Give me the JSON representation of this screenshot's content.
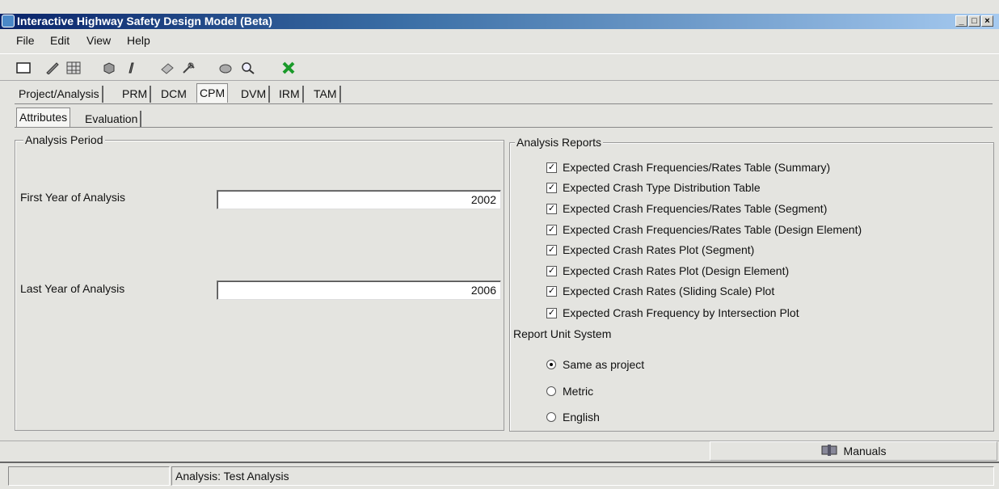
{
  "window": {
    "title": "Interactive Highway Safety Design Model (Beta)",
    "controls": [
      "_",
      "□",
      "×"
    ]
  },
  "menu": [
    "File",
    "Edit",
    "View",
    "Help"
  ],
  "toolbar": {
    "icons": [
      "new-icon",
      "edit-icon",
      "grid-icon",
      "box-icon",
      "pen-icon",
      "erase-icon",
      "tools-icon",
      "print-icon",
      "find-icon",
      "exit-icon"
    ]
  },
  "main_tabs": [
    "Project/Analysis",
    "PRM",
    "DCM",
    "CPM",
    "DVM",
    "IRM",
    "TAM"
  ],
  "active_main_tab": "CPM",
  "sub_tabs": [
    "Attributes",
    "Evaluation"
  ],
  "active_sub_tab": "Attributes",
  "analysis_period": {
    "legend": "Analysis Period",
    "first_year_label": "First Year of Analysis",
    "first_year_value": "2002",
    "last_year_label": "Last Year of Analysis",
    "last_year_value": "2006"
  },
  "analysis_reports": {
    "legend": "Analysis Reports",
    "items": [
      {
        "label": "Expected Crash Frequencies/Rates Table (Summary)",
        "checked": true
      },
      {
        "label": "Expected Crash Type Distribution Table",
        "checked": true
      },
      {
        "label": "Expected Crash Frequencies/Rates Table (Segment)",
        "checked": true
      },
      {
        "label": "Expected Crash Frequencies/Rates Table (Design Element)",
        "checked": true
      },
      {
        "label": "Expected Crash Rates Plot (Segment)",
        "checked": true
      },
      {
        "label": "Expected Crash Rates Plot (Design Element)",
        "checked": true
      },
      {
        "label": "Expected Crash Rates (Sliding Scale) Plot",
        "checked": true
      },
      {
        "label": "Expected Crash Frequency by Intersection Plot",
        "checked": true
      }
    ],
    "unit_system_label": "Report Unit System",
    "unit_options": [
      {
        "label": "Same as project",
        "selected": true
      },
      {
        "label": "Metric",
        "selected": false
      },
      {
        "label": "English",
        "selected": false
      }
    ]
  },
  "manuals_label": "Manuals",
  "status": {
    "left": "",
    "analysis": "Analysis: Test Analysis"
  }
}
